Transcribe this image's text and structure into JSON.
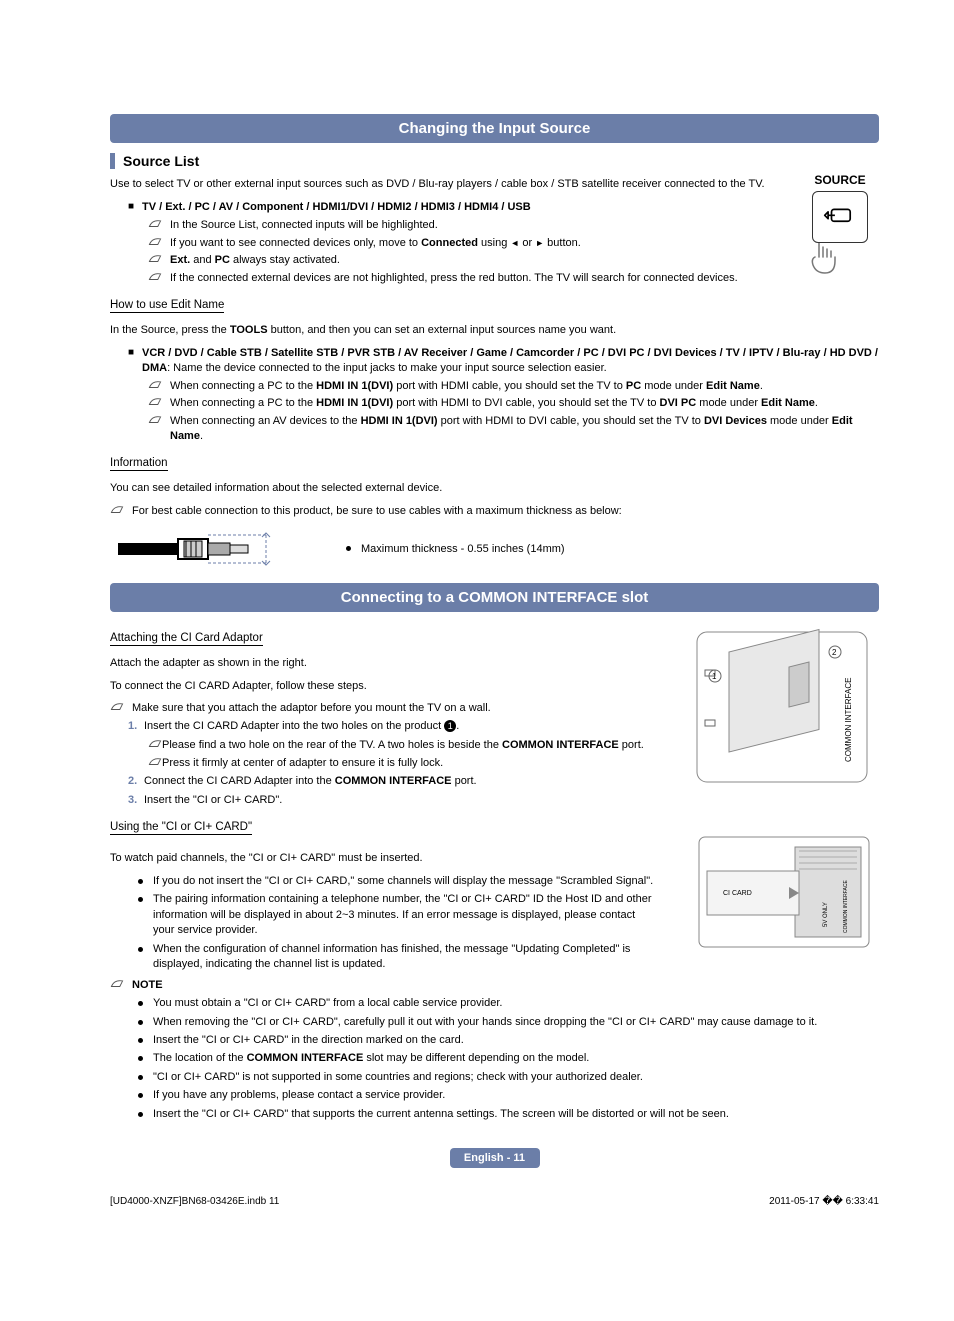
{
  "banner1": "Changing the Input Source",
  "sub1": "Source List",
  "sourceBox": {
    "title": "SOURCE"
  },
  "intro1": "Use to select TV or other external input sources such as DVD / Blu-ray players / cable box / STB satellite receiver connected to the TV.",
  "inputs_bold": "TV / Ext. / PC / AV / Component / HDMI1/DVI / HDMI2 / HDMI3 / HDMI4 / USB",
  "notes1": {
    "a": "In the Source List, connected inputs will be highlighted.",
    "b_pre": "If you want to see connected devices only, move to ",
    "b_bold": "Connected",
    "b_mid": " using ",
    "b_arrow_l": "◄",
    "b_or": " or ",
    "b_arrow_r": "►",
    "b_post": " button.",
    "c_pre": "",
    "c_b1": "Ext.",
    "c_mid": " and ",
    "c_b2": "PC",
    "c_post": " always stay activated.",
    "d": "If the connected external devices are not highlighted, press the red button. The TV will search for connected devices."
  },
  "editName": {
    "title": "How to use Edit Name",
    "line1_pre": "In the Source, press the ",
    "line1_bold": "TOOLS",
    "line1_post": " button, and then you can set an external input sources name you want.",
    "devices_bold": "VCR / DVD / Cable STB / Satellite STB / PVR STB / AV Receiver / Game / Camcorder / PC / DVI PC / DVI Devices / TV / IPTV / Blu-ray / HD DVD / DMA",
    "devices_post": ": Name the device connected to the input jacks to make your input source selection easier.",
    "n1_pre": "When connecting a PC to the ",
    "n1_b1": "HDMI IN 1(DVI)",
    "n1_mid": " port with HDMI cable, you should set the TV to ",
    "n1_b2": "PC",
    "n1_mid2": " mode under ",
    "n1_b3": "Edit Name",
    "n1_post": ".",
    "n2_pre": "When connecting a PC to the ",
    "n2_b1": "HDMI IN 1(DVI)",
    "n2_mid": " port with HDMI to DVI cable, you should set the TV to ",
    "n2_b2": "DVI PC",
    "n2_mid2": " mode under ",
    "n2_b3": "Edit Name",
    "n2_post": ".",
    "n3_pre": "When connecting an AV devices to the ",
    "n3_b1": "HDMI IN 1(DVI)",
    "n3_mid": " port with HDMI to DVI cable, you should set the TV to ",
    "n3_b2": "DVI Devices",
    "n3_mid2": " mode under ",
    "n3_b3": "Edit Name",
    "n3_post": "."
  },
  "info": {
    "title": "Information",
    "line": "You can see detailed information about the selected external device.",
    "cable_note": "For best cable connection to this product, be sure to use cables with a maximum thickness as below:",
    "cable_bullet": "Maximum thickness - 0.55 inches (14mm)"
  },
  "banner2": "Connecting to a COMMON INTERFACE slot",
  "ci": {
    "t1": "Attaching the CI Card Adaptor",
    "a1": "Attach the adapter as shown in the right.",
    "a2": "To connect the CI CARD Adapter, follow these steps.",
    "warn": "Make sure that you attach the adaptor before you mount the TV on a wall.",
    "s1_pre": "Insert the CI CARD Adapter into the two holes on the product ",
    "s1_num": "1",
    "s1_post": ".",
    "s1n1_pre": "Please find a two hole on the rear of the TV. A two holes is beside the ",
    "s1n1_bold": "COMMON INTERFACE",
    "s1n1_post": " port.",
    "s1n2": "Press it firmly at center of adapter to ensure it is fully lock.",
    "s2_pre": "Connect the CI CARD Adapter into the ",
    "s2_bold": "COMMON INTERFACE",
    "s2_post": " port.",
    "s3": "Insert the \"CI or CI+ CARD\".",
    "t2": "Using the \"CI or CI+ CARD\"",
    "u1": "To watch paid channels, the \"CI or CI+ CARD\" must be inserted.",
    "b1": "If you do not insert the \"CI or CI+ CARD,\" some channels will display the message \"Scrambled Signal\".",
    "b2": "The pairing information containing a telephone number, the \"CI or CI+ CARD\" ID the Host ID and other information will be displayed in about 2~3 minutes. If an error message is displayed, please contact your service provider.",
    "b3": "When the configuration of channel information has finished, the message \"Updating Completed\" is displayed, indicating the channel list is updated.",
    "noteHead": "NOTE",
    "nb1": "You must obtain a \"CI or CI+ CARD\" from a local cable service provider.",
    "nb2": "When removing the \"CI or CI+ CARD\", carefully pull it out with your hands since dropping the \"CI or CI+ CARD\" may cause damage to it.",
    "nb3": "Insert the \"CI or CI+ CARD\" in the direction marked on the card.",
    "nb4_pre": "The location of the ",
    "nb4_bold": "COMMON INTERFACE",
    "nb4_post": " slot may be different depending on the model.",
    "nb5": "\"CI or CI+ CARD\" is not supported in some countries and regions; check with your authorized dealer.",
    "nb6": "If you have any problems, please contact a service provider.",
    "nb7": "Insert the \"CI or CI+ CARD\" that supports the current antenna settings. The screen will be distorted or will not be seen."
  },
  "figLabels": {
    "commonInterface": "COMMON INTERFACE",
    "ciCard": "CI CARD",
    "fiveV": "5V ONLY"
  },
  "pageBadge": "English - 11",
  "footer": {
    "left": "[UD4000-XNZF]BN68-03426E.indb   11",
    "right": "2011-05-17   �� 6:33:41"
  }
}
